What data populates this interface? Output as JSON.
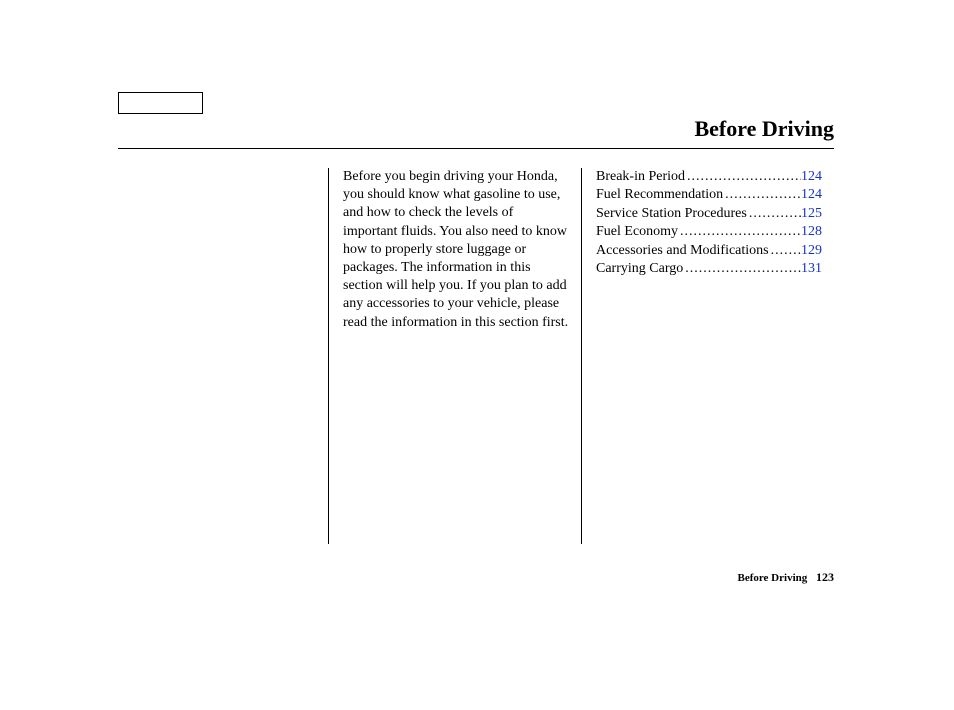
{
  "header": {
    "title": "Before Driving"
  },
  "intro": "Before you begin driving your Honda, you should know what gasoline to use, and how to check the levels of important fluids. You also need to know how to properly store luggage or packages. The information in this section will help you. If you plan to add any accessories to your vehicle, please read the information in this section first.",
  "toc": [
    {
      "label": "Break-in Period",
      "page": "124"
    },
    {
      "label": "Fuel Recommendation",
      "page": "124"
    },
    {
      "label": "Service Station Procedures",
      "page": "125"
    },
    {
      "label": "Fuel Economy",
      "page": "128"
    },
    {
      "label": "Accessories and Modifications",
      "page": "129"
    },
    {
      "label": "Carrying Cargo",
      "page": "131"
    }
  ],
  "footer": {
    "label": "Before Driving",
    "page": "123"
  }
}
